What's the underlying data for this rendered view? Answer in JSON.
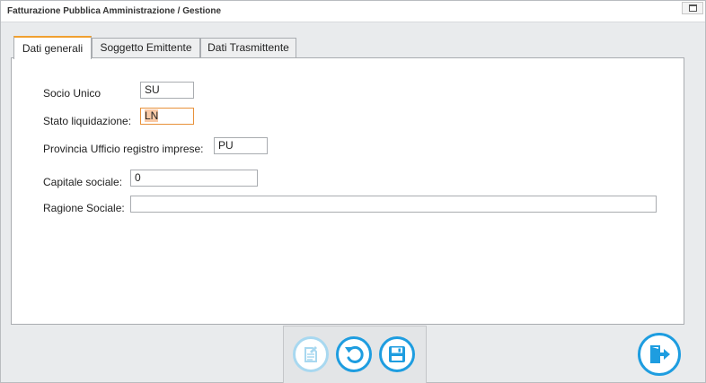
{
  "window": {
    "title": "Fatturazione Pubblica Amministrazione / Gestione"
  },
  "tabs": [
    {
      "label": "Dati generali",
      "active": true
    },
    {
      "label": "Soggetto Emittente",
      "active": false
    },
    {
      "label": "Dati Trasmittente",
      "active": false
    }
  ],
  "form": {
    "socio_unico": {
      "label": "Socio Unico",
      "value": "SU"
    },
    "stato_liquidazione": {
      "label": "Stato liquidazione:",
      "value": "LN"
    },
    "provincia_ufficio": {
      "label": "Provincia Ufficio registro imprese:",
      "value": "PU"
    },
    "capitale_sociale": {
      "label": "Capitale sociale:",
      "value": "0"
    },
    "ragione_sociale": {
      "label": "Ragione Sociale:",
      "value": ""
    }
  },
  "toolbar": {
    "edit_icon": "edit-document-icon",
    "undo_icon": "undo-icon",
    "save_icon": "save-icon",
    "exit_icon": "exit-icon"
  },
  "colors": {
    "accent": "#1e9de0",
    "accent_disabled": "#a8d8f0",
    "active_tab_top": "#f0a030",
    "focus_border": "#e8913a",
    "selection": "#f9c9a5"
  }
}
